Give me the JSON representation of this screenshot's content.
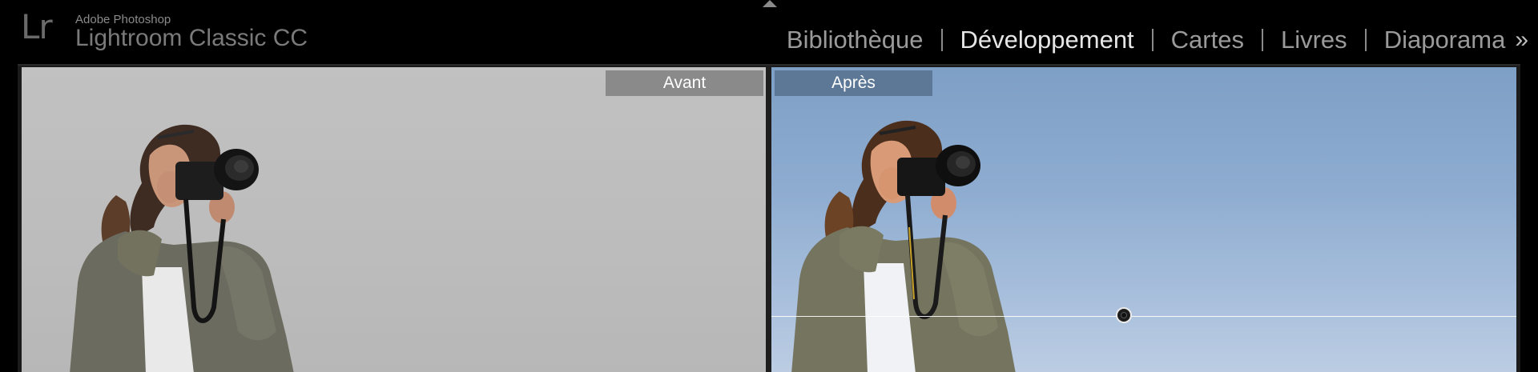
{
  "app": {
    "vendor": "Adobe Photoshop",
    "name": "Lightroom Classic CC",
    "logo": "Lr"
  },
  "modules": [
    {
      "label": "Bibliothèque",
      "active": false
    },
    {
      "label": "Développement",
      "active": true
    },
    {
      "label": "Cartes",
      "active": false
    },
    {
      "label": "Livres",
      "active": false
    },
    {
      "label": "Diaporama",
      "active": false
    }
  ],
  "more_modules_glyph": "»",
  "view": {
    "before_label": "Avant",
    "after_label": "Après"
  },
  "colors": {
    "active_module": "#e6e6e6",
    "inactive_module": "#9a9a9a",
    "before_label_bg": "#8a8a8a",
    "after_label_bg": "#5d7896",
    "sky_after": "#8eacd0"
  },
  "icons": {
    "collapse": "triangle-up-icon",
    "more": "double-chevron-right-icon",
    "gradient_pin": "graduated-filter-pin-icon"
  }
}
